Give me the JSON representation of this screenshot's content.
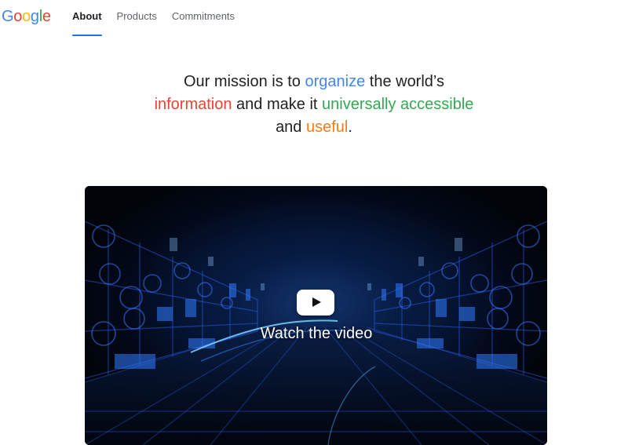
{
  "header": {
    "logo_letters": [
      {
        "text": "G",
        "color": "#4285f4"
      },
      {
        "text": "o",
        "color": "#ea4335"
      },
      {
        "text": "o",
        "color": "#fbbc05"
      },
      {
        "text": "g",
        "color": "#4285f4"
      },
      {
        "text": "l",
        "color": "#34a853"
      },
      {
        "text": "e",
        "color": "#ea4335"
      }
    ],
    "nav": [
      {
        "label": "About",
        "active": true
      },
      {
        "label": "Products",
        "active": false
      },
      {
        "label": "Commitments",
        "active": false
      }
    ],
    "active_underline_color": "#1a73e8"
  },
  "mission": {
    "part1": "Our mission is to ",
    "word_organize": "organize",
    "part2": " the world’s",
    "word_information": "information",
    "part3": " and make it ",
    "word_universally_accessible": "universally accessible",
    "part4": "and ",
    "word_useful": "useful",
    "part5": ".",
    "colors": {
      "organize": "#4285f4",
      "information": "#ea4335",
      "universally_accessible": "#34a853",
      "useful": "#fa7b17"
    }
  },
  "video": {
    "caption": "Watch the video",
    "play_icon": "play-icon",
    "background_color": "#03091a",
    "accent_color": "#2f7bff"
  }
}
